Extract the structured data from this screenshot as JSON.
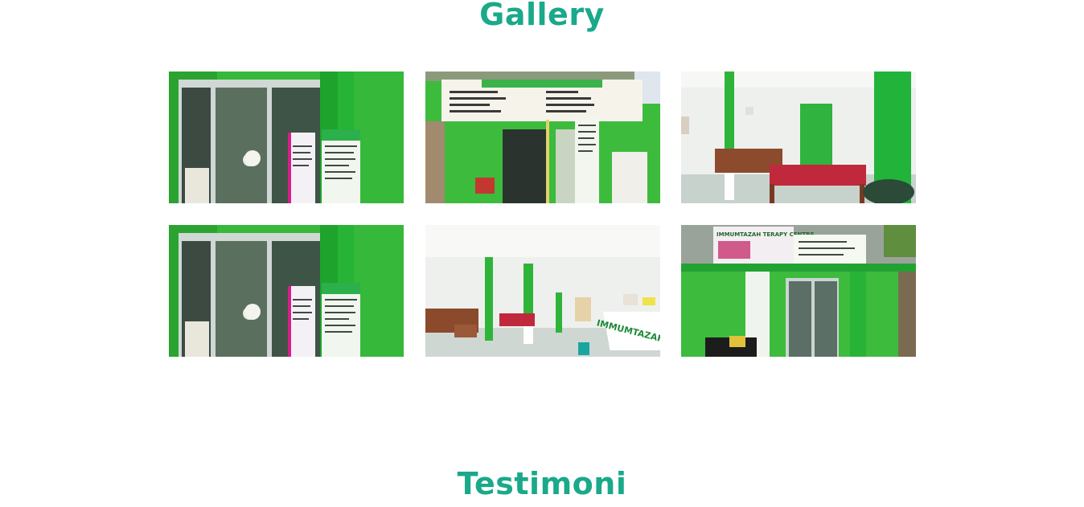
{
  "gallery": {
    "title": "Gallery",
    "photos": [
      {
        "subject": "front glass door with banners",
        "scene": "door"
      },
      {
        "subject": "storefront with services signboard",
        "scene": "storefront"
      },
      {
        "subject": "treatment room with red bed and curtains",
        "scene": "room"
      },
      {
        "subject": "front glass door with banners",
        "scene": "door"
      },
      {
        "subject": "waiting area with IMMUMTAZAH reception desk",
        "scene": "lobby",
        "desk_text": "IMMUMTAZAH"
      },
      {
        "subject": "building facade with Immumtazah Terapy Centre banner",
        "scene": "facade",
        "banner_text": "IMMUMTAZAH TERAPY CENTRE"
      }
    ]
  },
  "testimoni": {
    "title": "Testimoni"
  },
  "colors": {
    "accent": "#1aa98a",
    "wall_green": "#3dbb3d",
    "curtain_green": "#22b43a"
  }
}
